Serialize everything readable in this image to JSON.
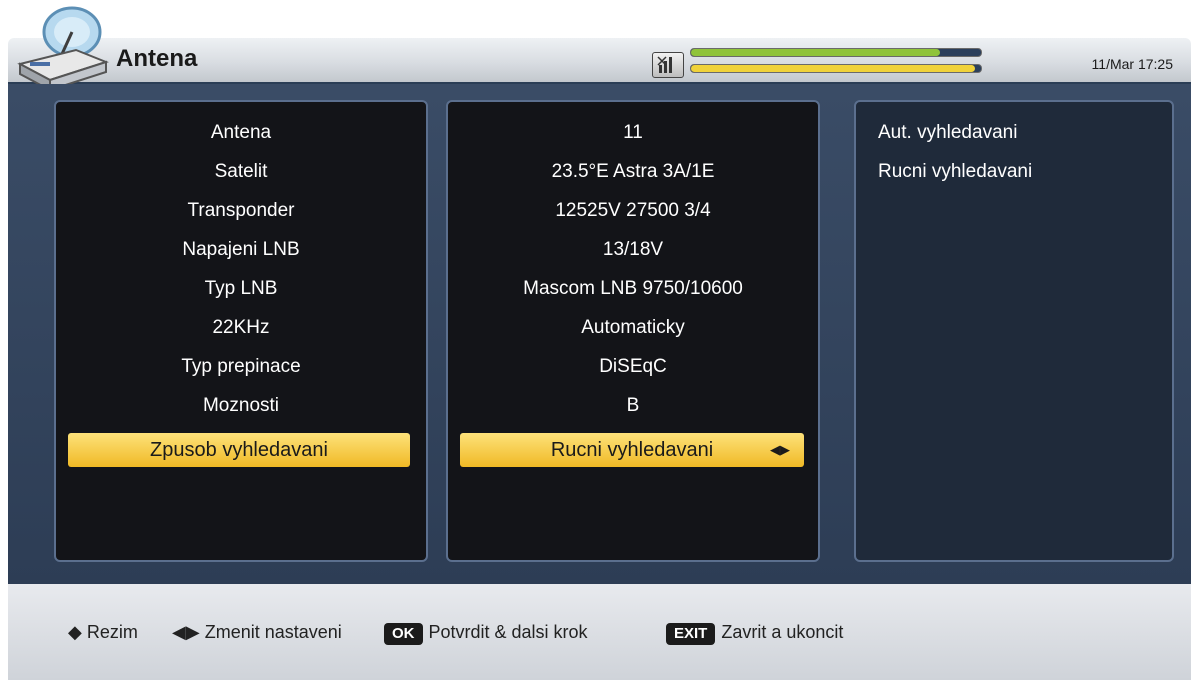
{
  "header": {
    "title": "Antena",
    "clock": "11/Mar 17:25",
    "signal_strength": 0.86,
    "signal_quality": 0.98
  },
  "settings": [
    {
      "label": "Antena",
      "value": "11"
    },
    {
      "label": "Satelit",
      "value": "23.5°E Astra 3A/1E"
    },
    {
      "label": "Transponder",
      "value": "12525V 27500 3/4"
    },
    {
      "label": "Napajeni LNB",
      "value": "13/18V"
    },
    {
      "label": "Typ LNB",
      "value": "Mascom LNB 9750/10600"
    },
    {
      "label": "22KHz",
      "value": "Automaticky"
    },
    {
      "label": "Typ prepinace",
      "value": "DiSEqC"
    },
    {
      "label": "Moznosti",
      "value": "B"
    },
    {
      "label": "Zpusob vyhledavani",
      "value": "Rucni vyhledavani"
    }
  ],
  "options": [
    "Aut. vyhledavani",
    "Rucni vyhledavani"
  ],
  "footer": {
    "mode_label": "Rezim",
    "change_label": "Zmenit nastaveni",
    "ok_key": "OK",
    "ok_label": "Potvrdit & dalsi krok",
    "exit_key": "EXIT",
    "exit_label": "Zavrit a ukoncit"
  },
  "colors": {
    "highlight": "#f6c940",
    "signal_bar": "#8fc33a",
    "quality_bar": "#f0d23a"
  }
}
